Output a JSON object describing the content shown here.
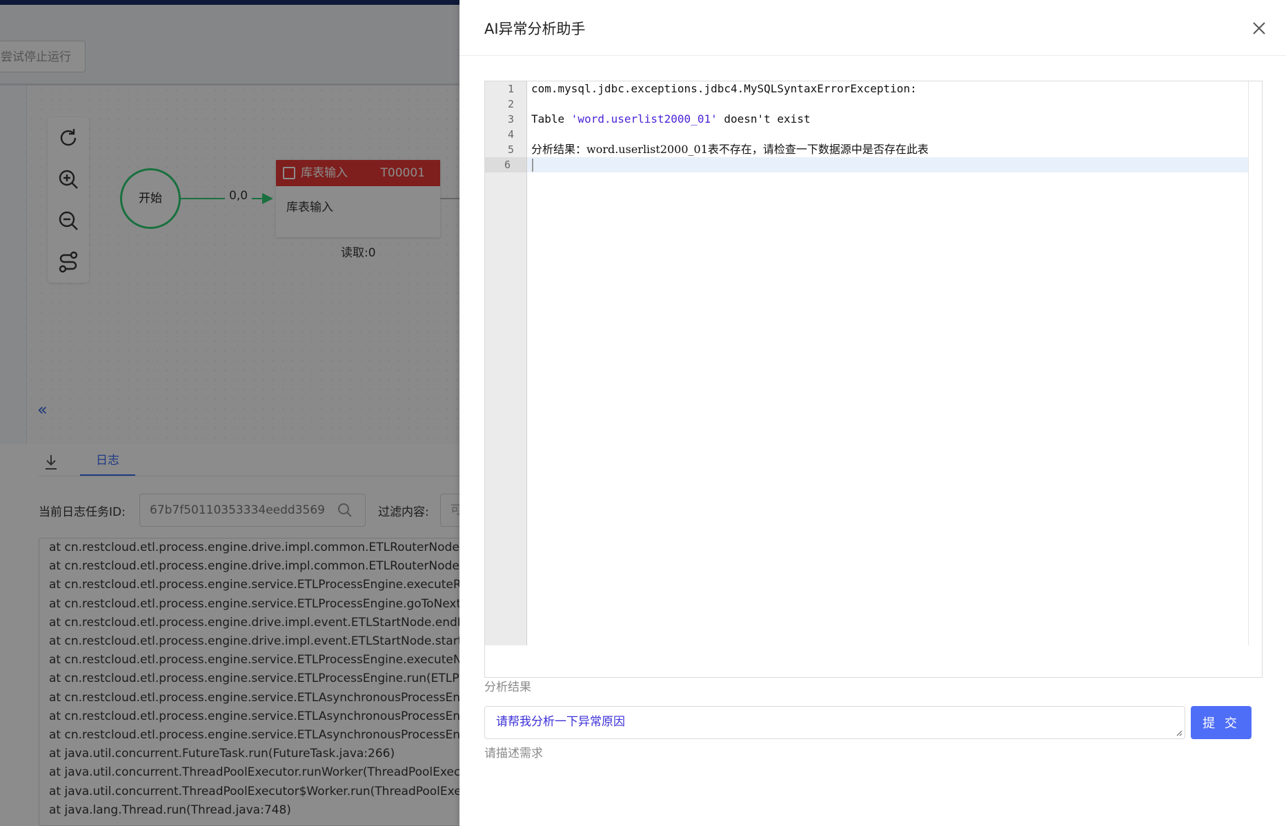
{
  "toolbar": {
    "stop_label": "尝试停止运行"
  },
  "canvas": {
    "start_node": {
      "label": "开始"
    },
    "edge_label": "0,0",
    "node": {
      "title": "库表输入",
      "code": "T00001",
      "body": "库表输入",
      "read": "读取:0"
    },
    "tool_icons": [
      "refresh-icon",
      "zoom-in-icon",
      "zoom-out-icon",
      "route-icon"
    ]
  },
  "log_panel": {
    "tab_log": "日志",
    "task_id_label": "当前日志任务ID:",
    "task_id_value": "67b7f50110353334eedd3569",
    "filter_label": "过滤内容:",
    "filter_placeholder": "可",
    "lines": [
      "at cn.restcloud.etl.process.engine.drive.impl.common.ETLRouterNode",
      "at cn.restcloud.etl.process.engine.drive.impl.common.ETLRouterNode",
      "at cn.restcloud.etl.process.engine.service.ETLProcessEngine.executeRo",
      "at cn.restcloud.etl.process.engine.service.ETLProcessEngine.goToNext",
      "at cn.restcloud.etl.process.engine.drive.impl.event.ETLStartNode.endN",
      "at cn.restcloud.etl.process.engine.drive.impl.event.ETLStartNode.start",
      "at cn.restcloud.etl.process.engine.service.ETLProcessEngine.executeN",
      "at cn.restcloud.etl.process.engine.service.ETLProcessEngine.run(ETLPr",
      "at cn.restcloud.etl.process.engine.service.ETLAsynchronousProcessEng",
      "at cn.restcloud.etl.process.engine.service.ETLAsynchronousProcessEng",
      "at cn.restcloud.etl.process.engine.service.ETLAsynchronousProcessEng",
      "at java.util.concurrent.FutureTask.run(FutureTask.java:266)",
      "at java.util.concurrent.ThreadPoolExecutor.runWorker(ThreadPoolExec",
      "at java.util.concurrent.ThreadPoolExecutor$Worker.run(ThreadPoolExe",
      "at java.lang.Thread.run(Thread.java:748)"
    ]
  },
  "drawer": {
    "title": "AI异常分析助手",
    "editor": {
      "line_numbers": [
        "1",
        "2",
        "3",
        "4",
        "5",
        "6"
      ],
      "line1": "com.mysql.jdbc.exceptions.jdbc4.MySQLSyntaxErrorException:",
      "line3_prefix": "Table ",
      "line3_string": "'word.userlist2000_01'",
      "line3_suffix": " doesn't exist",
      "line5": "分析结果：word.userlist2000_01表不存在，请检查一下数据源中是否存在此表"
    },
    "editor_hint": "分析结果",
    "ask_value": "请帮我分析一下异常原因",
    "ask_hint": "请描述需求",
    "submit_label": "提 交"
  },
  "colors": {
    "accent": "#4f6ef7",
    "node_header": "#e53935",
    "start_node": "#2ecc71",
    "topbar": "#1c2f6b"
  }
}
